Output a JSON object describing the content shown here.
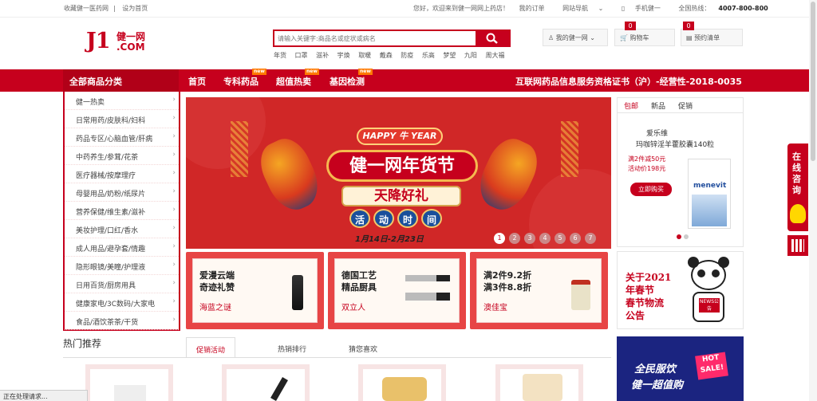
{
  "topbar": {
    "fav": "收藏健一医药网",
    "home": "设为首页",
    "welcome": "您好，欢迎来到健一网网上药店！",
    "login": "我的订单",
    "sitenav": "网站导航",
    "mobile": "手机健一",
    "hotline_label": "全国热线：",
    "hotline": "4007-800-800"
  },
  "logo": {
    "j1": "J1",
    "cn": "健一网",
    "com": ".COM"
  },
  "search": {
    "placeholder": "请输入关键字:商品名或症状或病名",
    "keywords": [
      "年货",
      "口罩",
      "滋补",
      "宇焕",
      "取暖",
      "戴森",
      "防疫",
      "乐高",
      "梦望",
      "九阳",
      "周大福"
    ]
  },
  "header_buttons": {
    "account": "我的健一网",
    "cart": "购物车",
    "cart_count": "0",
    "list": "预约清单",
    "list_count": "0"
  },
  "nav": {
    "all": "全部商品分类",
    "items": [
      "首页",
      "专科药品",
      "超值热卖",
      "基因检测"
    ],
    "new_tag": "new",
    "cert": "互联网药品信息服务资格证书（沪）-经营性-2018-0035"
  },
  "categories": [
    "健一热卖",
    "日常用药/皮肤科/妇科",
    "药品专区/心脑血管/肝病",
    "中药养生/参茸/花茶",
    "医疗器械/按摩理疗",
    "母婴用品/奶粉/纸尿片",
    "营养保健/维生素/滋补",
    "美妆护理/口红/香水",
    "成人用品/避孕套/情趣",
    "隐形眼镜/美瞳/护理液",
    "日用百货/厨房用具",
    "健康家电/3C数码/大家电",
    "食品/酒饮茶茶/干货"
  ],
  "banner": {
    "happy": "HAPPY 牛 YEAR",
    "title": "健一网年货节",
    "sub": "天降好礼",
    "time": [
      "活",
      "动",
      "时",
      "间"
    ],
    "date": "1月14日-2月23日",
    "dots": [
      "1",
      "2",
      "3",
      "4",
      "5",
      "6",
      "7"
    ]
  },
  "promos": [
    {
      "t1": "爱漫云端",
      "t2": "奇迹礼赞",
      "t3": "海蓝之谜"
    },
    {
      "t1": "德国工艺",
      "t2": "精品厨具",
      "t3": "双立人"
    },
    {
      "t1": "满2件9.2折",
      "t2": "满3件8.8折",
      "t3": "澳佳宝"
    }
  ],
  "rpanel": {
    "tabs": [
      "包邮",
      "新品",
      "促销"
    ],
    "brand": "爱乐维",
    "product": "玛咖锌淫羊藿胶囊140粒",
    "offer1": "满2件减50元",
    "offer2": "活动价198元",
    "buy": "立即购买",
    "box_brand": "menevit"
  },
  "notice": {
    "text": "关于2021年春节春节物流公告",
    "line1": "关于2021",
    "line2": "年春节",
    "line3": "春节物流",
    "line4": "公告",
    "tag": "NEWS公告"
  },
  "hot": {
    "title": "热门推荐",
    "tabs": [
      "促销活动",
      "热销排行",
      "猜您喜欢"
    ]
  },
  "ad_small": {
    "l1": "全民服饮",
    "l2": "健一超值购",
    "hot": "HOT SALE!"
  },
  "side": {
    "text": "在线咨询"
  },
  "status": "正在处理请求...",
  "colors": {
    "brand": "#c6001d",
    "nav_dark": "#b10018",
    "accent_orange": "#ff7a00"
  }
}
